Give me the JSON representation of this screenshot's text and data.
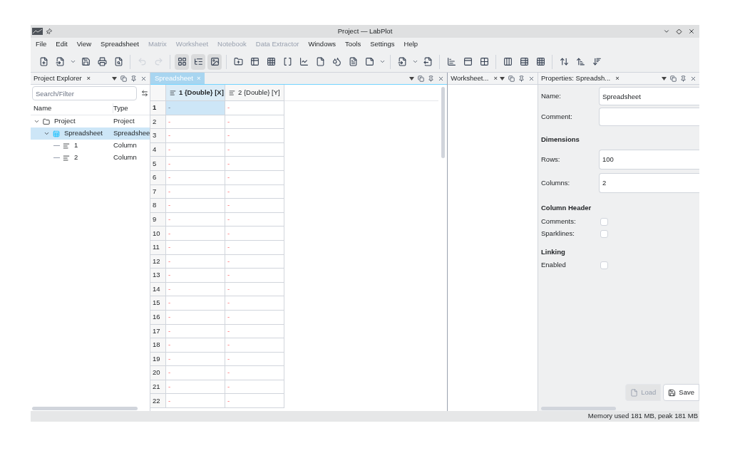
{
  "window": {
    "title": "Project — LabPlot"
  },
  "menu": [
    {
      "label": "File",
      "disabled": false
    },
    {
      "label": "Edit",
      "disabled": false
    },
    {
      "label": "View",
      "disabled": false
    },
    {
      "label": "Spreadsheet",
      "disabled": false
    },
    {
      "label": "Matrix",
      "disabled": true
    },
    {
      "label": "Worksheet",
      "disabled": true
    },
    {
      "label": "Notebook",
      "disabled": true
    },
    {
      "label": "Data Extractor",
      "disabled": true
    },
    {
      "label": "Windows",
      "disabled": false
    },
    {
      "label": "Tools",
      "disabled": false
    },
    {
      "label": "Settings",
      "disabled": false
    },
    {
      "label": "Help",
      "disabled": false
    }
  ],
  "project_explorer": {
    "title": "Project Explorer",
    "close": "×",
    "search": {
      "placeholder": "Search/Filter"
    },
    "columns": [
      "Name",
      "Type"
    ],
    "tree": [
      {
        "name": "Project",
        "type": "Project",
        "kind": "project",
        "expanded": true,
        "selected": false,
        "children": [
          {
            "name": "Spreadsheet",
            "type": "Spreadshee",
            "kind": "spreadsheet",
            "expanded": true,
            "selected": true,
            "children": [
              {
                "name": "1",
                "type": "Column",
                "kind": "column",
                "selected": false
              },
              {
                "name": "2",
                "type": "Column",
                "kind": "column",
                "selected": false
              }
            ]
          }
        ]
      }
    ]
  },
  "spreadsheet": {
    "tab": {
      "label": "Spreadsheet",
      "close": "×"
    },
    "columns": [
      {
        "label": "1 {Double} [X]",
        "selected": true
      },
      {
        "label": "2 {Double} [Y]",
        "selected": false
      }
    ],
    "rows": [
      {
        "number": "1",
        "selected": true,
        "cells": [
          "-",
          "-"
        ]
      },
      {
        "number": "2",
        "selected": false,
        "cells": [
          "-",
          "-"
        ]
      },
      {
        "number": "3",
        "selected": false,
        "cells": [
          "-",
          "-"
        ]
      },
      {
        "number": "4",
        "selected": false,
        "cells": [
          "-",
          "-"
        ]
      },
      {
        "number": "5",
        "selected": false,
        "cells": [
          "-",
          "-"
        ]
      },
      {
        "number": "6",
        "selected": false,
        "cells": [
          "-",
          "-"
        ]
      },
      {
        "number": "7",
        "selected": false,
        "cells": [
          "-",
          "-"
        ]
      },
      {
        "number": "8",
        "selected": false,
        "cells": [
          "-",
          "-"
        ]
      },
      {
        "number": "9",
        "selected": false,
        "cells": [
          "-",
          "-"
        ]
      },
      {
        "number": "10",
        "selected": false,
        "cells": [
          "-",
          "-"
        ]
      },
      {
        "number": "11",
        "selected": false,
        "cells": [
          "-",
          "-"
        ]
      },
      {
        "number": "12",
        "selected": false,
        "cells": [
          "-",
          "-"
        ]
      },
      {
        "number": "13",
        "selected": false,
        "cells": [
          "-",
          "-"
        ]
      },
      {
        "number": "14",
        "selected": false,
        "cells": [
          "-",
          "-"
        ]
      },
      {
        "number": "15",
        "selected": false,
        "cells": [
          "-",
          "-"
        ]
      },
      {
        "number": "16",
        "selected": false,
        "cells": [
          "-",
          "-"
        ]
      },
      {
        "number": "17",
        "selected": false,
        "cells": [
          "-",
          "-"
        ]
      },
      {
        "number": "18",
        "selected": false,
        "cells": [
          "-",
          "-"
        ]
      },
      {
        "number": "19",
        "selected": false,
        "cells": [
          "-",
          "-"
        ]
      },
      {
        "number": "20",
        "selected": false,
        "cells": [
          "-",
          "-"
        ]
      },
      {
        "number": "21",
        "selected": false,
        "cells": [
          "-",
          "-"
        ]
      },
      {
        "number": "22",
        "selected": false,
        "cells": [
          "-",
          "-"
        ]
      }
    ]
  },
  "worksheet_dock": {
    "title": "Worksheet...",
    "close": "×"
  },
  "properties": {
    "title": "Properties: Spreadsh...",
    "close": "×",
    "name": {
      "label": "Name:",
      "value": "Spreadsheet"
    },
    "comment": {
      "label": "Comment:"
    },
    "dimensions": {
      "heading": "Dimensions",
      "rows": {
        "label": "Rows:",
        "value": "100"
      },
      "columns": {
        "label": "Columns:",
        "value": "2"
      }
    },
    "column_header": {
      "heading": "Column Header",
      "options": [
        {
          "label": "Comments:",
          "checked": false
        },
        {
          "label": "Sparklines:",
          "checked": false
        }
      ]
    },
    "linking": {
      "heading": "Linking",
      "options": [
        {
          "label": "Enabled",
          "checked": false
        }
      ]
    },
    "buttons": [
      {
        "label": "Load",
        "disabled": true
      },
      {
        "label": "Save",
        "disabled": false
      }
    ]
  },
  "status_bar": {
    "text": "Memory used 181 MB, peak 181 MB"
  }
}
